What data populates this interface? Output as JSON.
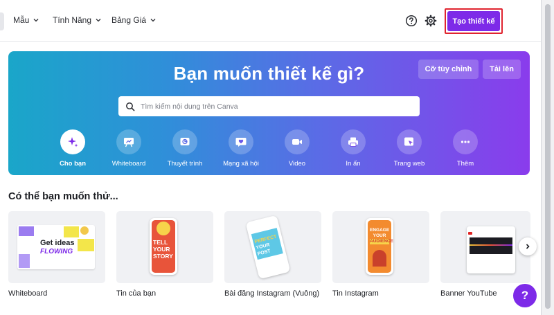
{
  "header": {
    "nav": [
      {
        "label": "Mẫu"
      },
      {
        "label": "Tính Năng"
      },
      {
        "label": "Bảng Giá"
      }
    ],
    "create_button": "Tạo thiết kế"
  },
  "hero": {
    "title": "Bạn muốn thiết kế gì?",
    "custom_size": "Cỡ tùy chỉnh",
    "upload": "Tải lên",
    "search_placeholder": "Tìm kiếm nội dung trên Canva",
    "categories": [
      {
        "label": "Cho bạn",
        "icon": "sparkle-icon"
      },
      {
        "label": "Whiteboard",
        "icon": "whiteboard-icon"
      },
      {
        "label": "Thuyết trình",
        "icon": "presentation-icon"
      },
      {
        "label": "Mạng xã hội",
        "icon": "heart-chat-icon"
      },
      {
        "label": "Video",
        "icon": "video-camera-icon"
      },
      {
        "label": "In ấn",
        "icon": "printer-icon"
      },
      {
        "label": "Trang web",
        "icon": "website-cursor-icon"
      },
      {
        "label": "Thêm",
        "icon": "more-dots-icon"
      }
    ]
  },
  "suggestions": {
    "title": "Có thể bạn muốn thử...",
    "items": [
      {
        "label": "Whiteboard",
        "thumb_text": [
          "Get ideas",
          "FLOWING"
        ]
      },
      {
        "label": "Tin của bạn",
        "thumb_text": [
          "TELL",
          "YOUR",
          "STORY"
        ]
      },
      {
        "label": "Bài đăng Instagram (Vuông)",
        "thumb_text": [
          "PERFECT",
          "YOUR POST"
        ]
      },
      {
        "label": "Tin Instagram",
        "thumb_text": [
          "ENGAGE",
          "YOUR",
          "AUDIENCE"
        ]
      },
      {
        "label": "Banner YouTube",
        "thumb_text": []
      }
    ]
  },
  "help_fab": "?",
  "colors": {
    "brand": "#7d2ae8",
    "highlight": "#e0242f"
  }
}
